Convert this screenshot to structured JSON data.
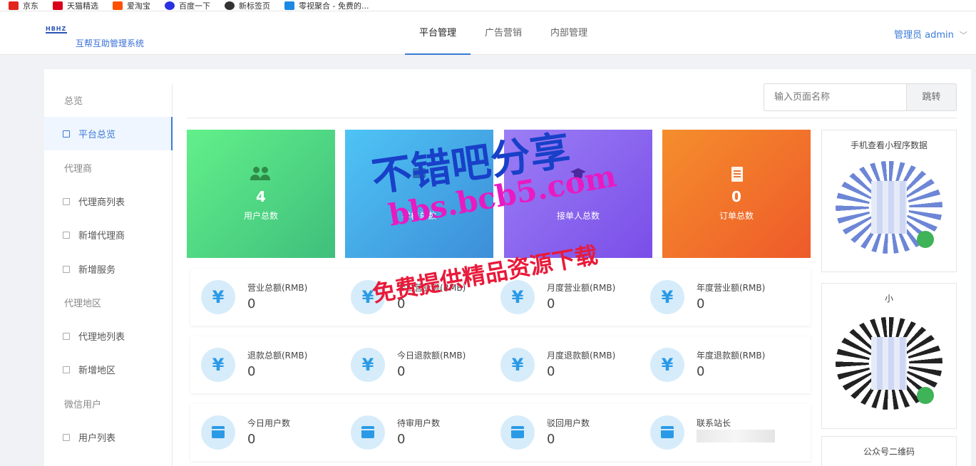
{
  "bookmarks": [
    {
      "label": "京东",
      "color": "#e1251b"
    },
    {
      "label": "天猫精选",
      "color": "#d9001b"
    },
    {
      "label": "爱淘宝",
      "color": "#ff5000"
    },
    {
      "label": "百度一下",
      "color": "#2932e1"
    },
    {
      "label": "新标签页",
      "color": "#333333"
    },
    {
      "label": "零视聚合 - 免费的...",
      "color": "#1e88e5"
    }
  ],
  "header": {
    "logo_mark": "HBHZ",
    "system_name": "互帮互助管理系统",
    "nav": [
      "平台管理",
      "广告营销",
      "内部管理"
    ],
    "active_nav": "平台管理",
    "user": "管理员 admin",
    "caret": "﹀"
  },
  "sidebar": {
    "overview": "总览",
    "platform_overview": "平台总览",
    "agent_group": "代理商",
    "agent_list": "代理商列表",
    "add_agent": "新增代理商",
    "add_service": "新增服务",
    "region_group": "代理地区",
    "region_list": "代理地列表",
    "add_region": "新增地区",
    "wechat_group": "微信用户",
    "user_list": "用户列表"
  },
  "search": {
    "placeholder": "输入页面名称",
    "button": "跳转"
  },
  "cards": {
    "users": {
      "value": "4",
      "label": "用户总数"
    },
    "schools": {
      "value": "",
      "label": "学校总数"
    },
    "takers": {
      "value": "",
      "label": "接单人总数"
    },
    "orders": {
      "value": "0",
      "label": "订单总数"
    }
  },
  "row1": [
    {
      "label": "营业总额(RMB)",
      "value": "0"
    },
    {
      "label": "今日营业额(RMB)",
      "value": "0"
    },
    {
      "label": "月度营业额(RMB)",
      "value": "0"
    },
    {
      "label": "年度营业额(RMB)",
      "value": "0"
    }
  ],
  "row2": [
    {
      "label": "退款总额(RMB)",
      "value": "0"
    },
    {
      "label": "今日退款额(RMB)",
      "value": "0"
    },
    {
      "label": "月度退款额(RMB)",
      "value": "0"
    },
    {
      "label": "年度退款额(RMB)",
      "value": "0"
    }
  ],
  "row3": [
    {
      "label": "今日用户数",
      "value": "0"
    },
    {
      "label": "待审用户数",
      "value": "0"
    },
    {
      "label": "驳回用户数",
      "value": "0"
    },
    {
      "label": "联系站长",
      "value": ""
    }
  ],
  "currency_symbol": "¥",
  "qr": {
    "mini_program_title": "手机查看小程序数据",
    "second_title": "小",
    "official_title": "公众号二维码"
  },
  "watermark": {
    "line1": "不错吧分享",
    "line2": "bbs.bcb5.com",
    "line3": "免费提供精品资源下载"
  }
}
